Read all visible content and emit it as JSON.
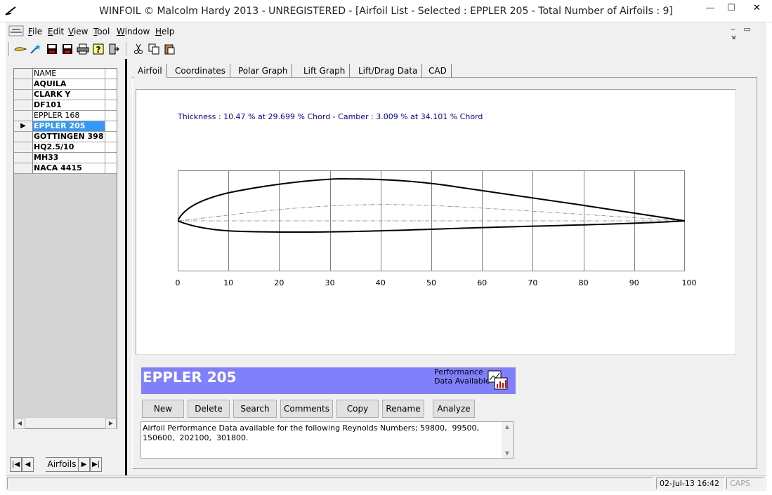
{
  "window": {
    "title": "WINFOIL © Malcolm Hardy 2013 - UNREGISTERED - [Airfoil List - Selected : EPPLER 205 - Total Number of Airfoils : 9]",
    "minimize": "—",
    "maximize": "☐",
    "close": "✕",
    "mdi_controls": "‒ ▭ ✕"
  },
  "menu": {
    "items": [
      {
        "label": "File",
        "key": "F",
        "rest": "ile"
      },
      {
        "label": "Edit",
        "key": "E",
        "rest": "dit"
      },
      {
        "label": "View",
        "key": "V",
        "rest": "iew"
      },
      {
        "label": "Tool",
        "key": "T",
        "rest": "ool"
      },
      {
        "label": "Window",
        "key": "W",
        "rest": "indow"
      },
      {
        "label": "Help",
        "key": "H",
        "rest": "elp"
      }
    ]
  },
  "toolbar": {
    "icons": [
      "airfoil-icon",
      "wand-icon",
      "save-icon",
      "save-as-icon",
      "print-icon",
      "help-icon",
      "exit-icon",
      "cut-icon",
      "copy-icon",
      "paste-icon"
    ]
  },
  "airfoil_list": {
    "header": "NAME",
    "rows": [
      {
        "name": "AQUILA",
        "bold": true
      },
      {
        "name": "CLARK Y",
        "bold": true
      },
      {
        "name": "DF101",
        "bold": true
      },
      {
        "name": "EPPLER 168",
        "bold": false
      },
      {
        "name": "EPPLER 205",
        "bold": true,
        "selected": true
      },
      {
        "name": "GOTTINGEN 398",
        "bold": true
      },
      {
        "name": "HQ2.5/10",
        "bold": true
      },
      {
        "name": "MH33",
        "bold": true
      },
      {
        "name": "NACA 4415",
        "bold": true
      }
    ],
    "current_row_marker": "▶"
  },
  "navigator": {
    "label": "Airfoils",
    "first": "|◀",
    "prev": "◀",
    "next": "▶",
    "last": "▶|"
  },
  "tabs": [
    {
      "label": "Airfoil",
      "active": true
    },
    {
      "label": "Coordinates"
    },
    {
      "label": "Polar Graph"
    },
    {
      "label": "Lift Graph"
    },
    {
      "label": "Lift/Drag Data"
    },
    {
      "label": "CAD"
    }
  ],
  "plot": {
    "info": "Thickness : 10.47 % at 29.699 % Chord - Camber : 3.009 % at 34.101 % Chord",
    "x_ticks": [
      "0",
      "10",
      "20",
      "30",
      "40",
      "50",
      "60",
      "70",
      "80",
      "90",
      "100"
    ]
  },
  "selected_airfoil": {
    "name": "EPPLER 205",
    "performance_label": "Performance Data Available"
  },
  "buttons": [
    "New",
    "Delete",
    "Search",
    "Comments",
    "Copy",
    "Rename",
    "Analyze"
  ],
  "info_text": "Airfoil Performance Data available for the following Reynolds Numbers; 59800,  99500,\n150600,  202100,  301800.",
  "status": {
    "message": "",
    "datetime": "02-Jul-13 16:42",
    "caps": "CAPS"
  },
  "colors": {
    "selection": "#3399ff",
    "banner": "#8080ff",
    "plot_text": "#0000aa"
  }
}
